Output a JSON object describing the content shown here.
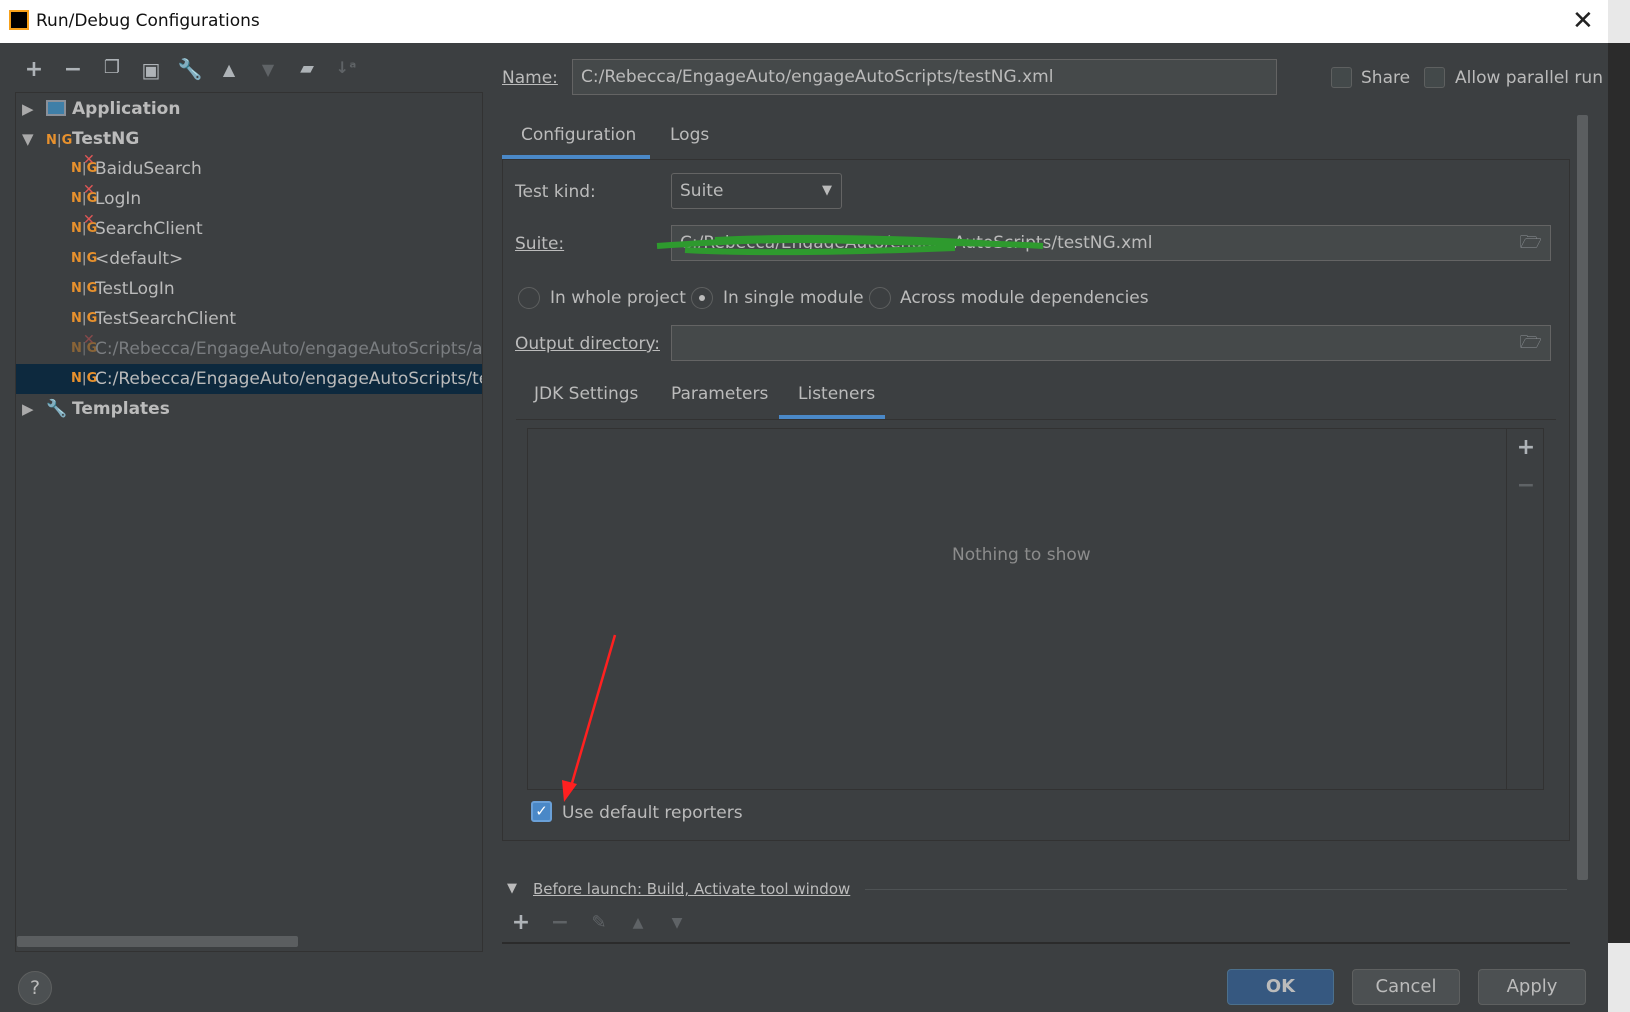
{
  "window": {
    "title": "Run/Debug Configurations",
    "app_icon": "intellij-icon",
    "close_icon": "close-icon"
  },
  "toolbar": {
    "icons": [
      "add-icon",
      "remove-icon",
      "copy-icon",
      "save-icon",
      "wrench-icon",
      "move-up-icon",
      "move-down-icon",
      "new-folder-icon",
      "sort-icon"
    ]
  },
  "tree": {
    "items": [
      {
        "label": "Application",
        "level": 0,
        "expanded": false,
        "bold": true,
        "icon": "application-icon"
      },
      {
        "label": "TestNG",
        "level": 0,
        "expanded": true,
        "bold": true,
        "icon": "testng-icon"
      },
      {
        "label": "BaiduSearch",
        "level": 1,
        "error": true
      },
      {
        "label": "LogIn",
        "level": 1,
        "error": true
      },
      {
        "label": "SearchClient",
        "level": 1,
        "error": true
      },
      {
        "label": "<default>",
        "level": 1
      },
      {
        "label": "TestLogIn",
        "level": 1
      },
      {
        "label": "TestSearchClient",
        "level": 1
      },
      {
        "label": "C:/Rebecca/EngageAuto/engageAutoScripts/aut",
        "level": 1,
        "error": true,
        "dim": true
      },
      {
        "label": "C:/Rebecca/EngageAuto/engageAutoScripts/test",
        "level": 1,
        "selected": true
      },
      {
        "label": "Templates",
        "level": 0,
        "expanded": false,
        "bold": true,
        "icon": "wrench-icon"
      }
    ]
  },
  "form": {
    "name_label": "Name:",
    "name_value": "C:/Rebecca/EngageAuto/engageAutoScripts/testNG.xml",
    "share_label": "Share",
    "share_checked": false,
    "parallel_label": "Allow parallel run",
    "parallel_checked": false,
    "tabs": [
      "Configuration",
      "Logs"
    ],
    "active_tab": "Configuration",
    "test_kind_label": "Test kind:",
    "test_kind_value": "Suite",
    "suite_label": "Suite:",
    "suite_value": "C:/Rebecca/EngageAuto/engageAutoScripts/testNG.xml",
    "radios": [
      "In whole project",
      "In single module",
      "Across module dependencies"
    ],
    "selected_radio": "In single module",
    "output_label": "Output directory:",
    "output_value": "",
    "subtabs": [
      "JDK Settings",
      "Parameters",
      "Listeners"
    ],
    "active_subtab": "Listeners",
    "empty_text": "Nothing to show",
    "use_default_label": "Use default reporters",
    "use_default_checked": true,
    "before_launch": "Before launch: Build, Activate tool window"
  },
  "buttons": {
    "ok": "OK",
    "cancel": "Cancel",
    "apply": "Apply",
    "help": "?"
  },
  "colors": {
    "accent": "#4a88c7",
    "ok_button": "#365880",
    "selection": "#0d293e",
    "annotation_arrow": "#ff2020",
    "scribble": "#2e9a2e"
  }
}
